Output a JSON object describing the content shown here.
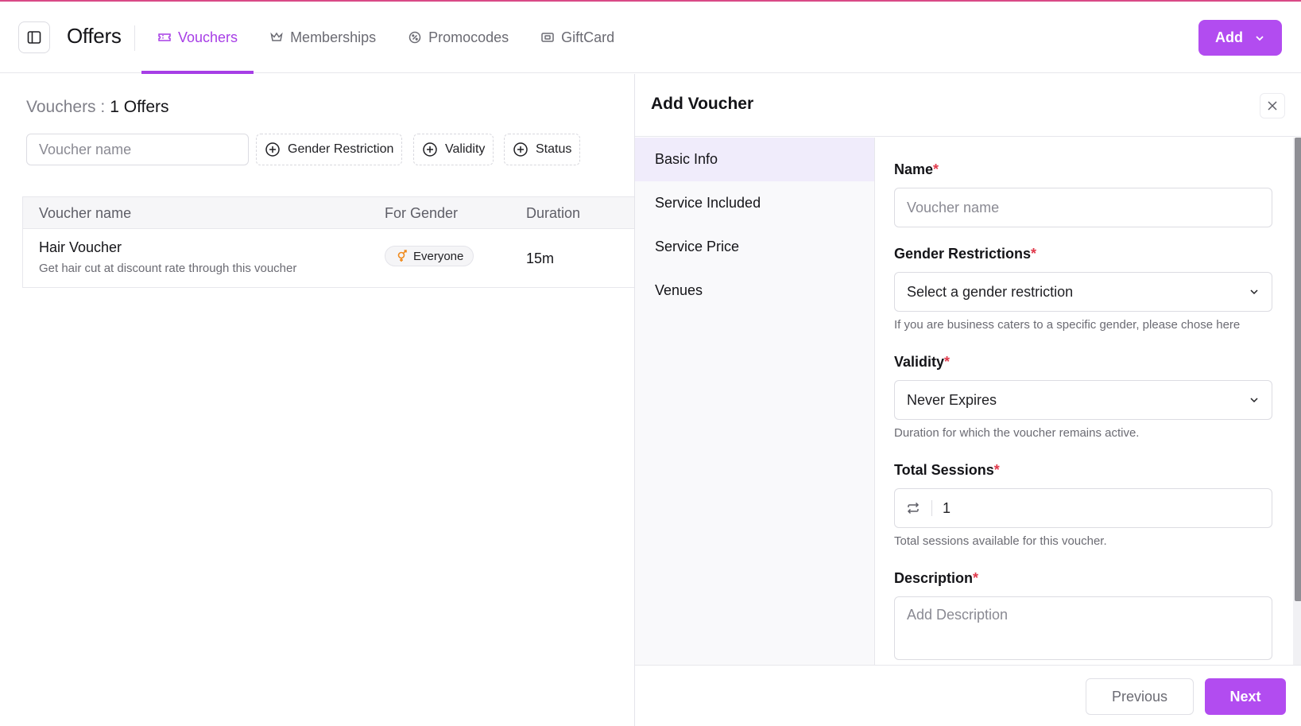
{
  "header": {
    "title": "Offers",
    "tabs": [
      {
        "label": "Vouchers",
        "icon": "ticket-icon",
        "active": true
      },
      {
        "label": "Memberships",
        "icon": "crown-icon",
        "active": false
      },
      {
        "label": "Promocodes",
        "icon": "badge-percent-icon",
        "active": false
      },
      {
        "label": "GiftCard",
        "icon": "gift-card-icon",
        "active": false
      }
    ],
    "add_label": "Add",
    "accent": "#a73ee6"
  },
  "list": {
    "summary_label": "Vouchers :",
    "summary_count": "1 Offers",
    "search_placeholder": "Voucher name",
    "filters": [
      "Gender Restriction",
      "Validity",
      "Status"
    ],
    "columns": [
      "Voucher name",
      "For Gender",
      "Duration"
    ],
    "rows": [
      {
        "name": "Hair Voucher",
        "description": "Get hair cut at discount rate through this voucher",
        "gender": "Everyone",
        "duration": "15m"
      }
    ]
  },
  "drawer": {
    "title": "Add Voucher",
    "steps": [
      {
        "label": "Basic Info",
        "active": true
      },
      {
        "label": "Service Included",
        "active": false
      },
      {
        "label": "Service Price",
        "active": false
      },
      {
        "label": "Venues",
        "active": false
      }
    ],
    "form": {
      "name": {
        "label": "Name",
        "required": "*",
        "placeholder": "Voucher name"
      },
      "gender": {
        "label": "Gender Restrictions",
        "required": "*",
        "value": "Select a gender restriction",
        "hint": "If you are business caters to a specific gender, please chose here"
      },
      "validity": {
        "label": "Validity",
        "required": "*",
        "value": "Never Expires",
        "hint": "Duration for which the voucher remains active."
      },
      "sessions": {
        "label": "Total Sessions",
        "required": "*",
        "value": "1",
        "hint": "Total sessions available for this voucher."
      },
      "description": {
        "label": "Description",
        "required": "*",
        "placeholder": "Add Description"
      }
    },
    "previous_label": "Previous",
    "next_label": "Next"
  }
}
